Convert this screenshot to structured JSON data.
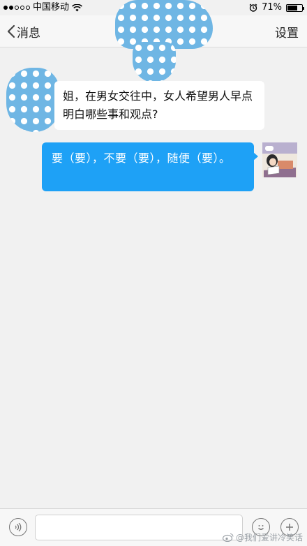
{
  "status_bar": {
    "carrier": "中国移动",
    "battery_text": "71%",
    "battery_level": 0.71,
    "icons": [
      "signal-dots-icon",
      "wifi-icon",
      "alarm-icon",
      "battery-icon"
    ]
  },
  "navbar": {
    "back_label": "消息",
    "right_label": "设置"
  },
  "messages": [
    {
      "direction": "incoming",
      "text": "姐，在男女交往中，女人希望男人早点明白哪些事和观点?"
    },
    {
      "direction": "outgoing",
      "text": "要（要），不要（要），随便（要）。"
    }
  ],
  "input_bar": {
    "input_value": "",
    "icons": [
      "voice-icon",
      "emoji-icon",
      "plus-icon"
    ]
  },
  "watermark": {
    "text": "@我们爱讲冷笑话"
  },
  "colors": {
    "background": "#f1f1f1",
    "outgoing_bubble": "#1ea1f6",
    "incoming_bubble": "#ffffff",
    "censor_blob": "#6fb6e4"
  }
}
